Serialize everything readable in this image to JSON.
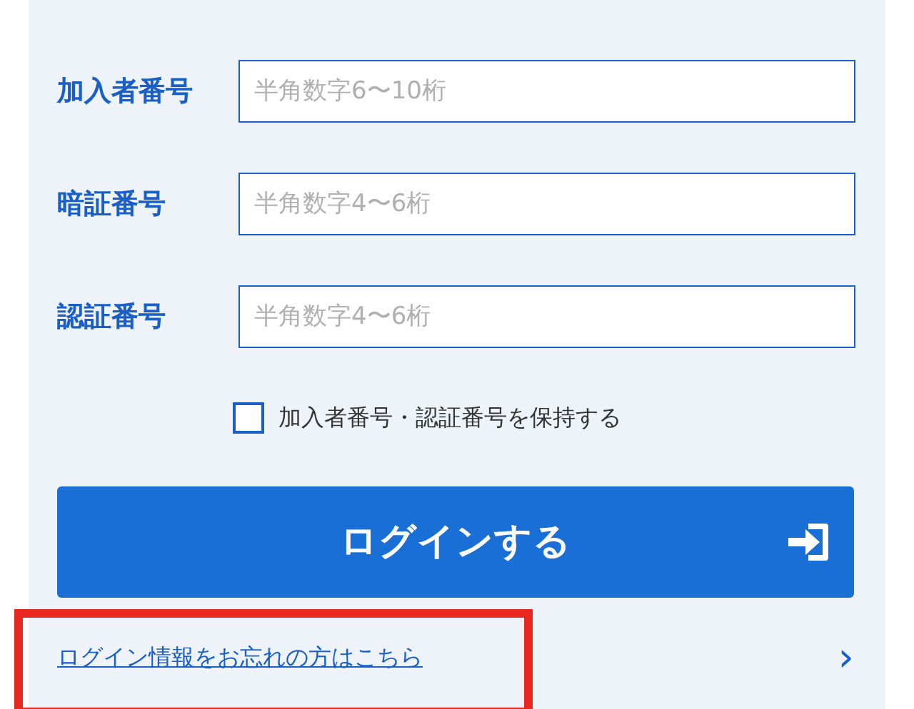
{
  "fields": [
    {
      "label": "加入者番号",
      "placeholder": "半角数字6〜10桁"
    },
    {
      "label": "暗証番号",
      "placeholder": "半角数字4〜6桁"
    },
    {
      "label": "認証番号",
      "placeholder": "半角数字4〜6桁"
    }
  ],
  "remember": {
    "label": "加入者番号・認証番号を保持する",
    "checked": false
  },
  "login_button": {
    "label": "ログインする"
  },
  "forgot_link": {
    "label": "ログイン情報をお忘れの方はこちら",
    "highlighted": true,
    "chevron": "›"
  }
}
